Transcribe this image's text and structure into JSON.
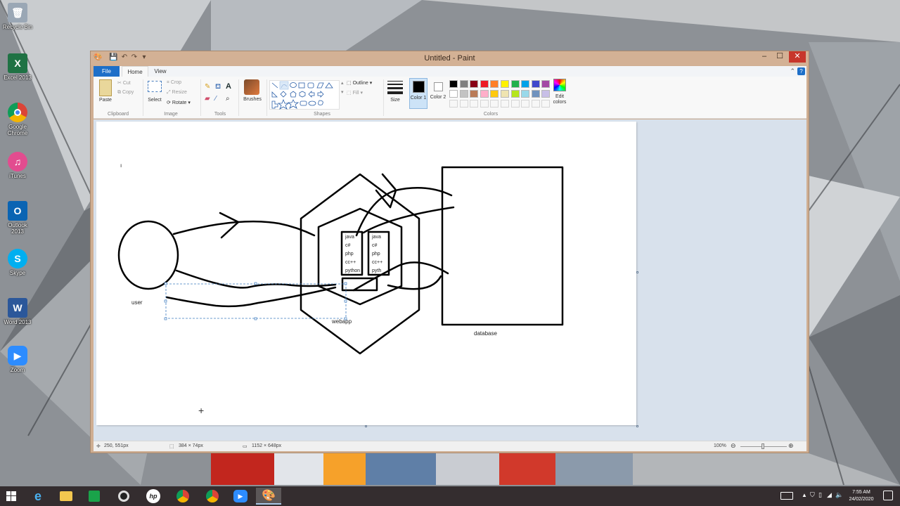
{
  "desktop": {
    "icons": [
      {
        "label": "Recycle Bin",
        "icon": "recycle-bin-icon",
        "color": "#9aa7b5"
      },
      {
        "label": "Excel 2013",
        "icon": "excel-icon",
        "color": "#1f7244"
      },
      {
        "label": "Google Chrome",
        "icon": "chrome-icon",
        "color": "#dd4b39"
      },
      {
        "label": "iTunes",
        "icon": "itunes-icon",
        "color": "#e24c8f"
      },
      {
        "label": "Outlook 2013",
        "icon": "outlook-icon",
        "color": "#0a64b3"
      },
      {
        "label": "Skype",
        "icon": "skype-icon",
        "color": "#00aff0"
      },
      {
        "label": "Word 2013",
        "icon": "word-icon",
        "color": "#2b579a"
      },
      {
        "label": "Zoom",
        "icon": "zoom-icon",
        "color": "#2d8cff"
      }
    ]
  },
  "window": {
    "title": "Untitled - Paint",
    "controls": {
      "minimize": "–",
      "maximize": "☐",
      "close": "✕"
    }
  },
  "ribbon": {
    "tabs": [
      "File",
      "Home",
      "View"
    ],
    "clipboard": {
      "paste": "Paste",
      "cut": "Cut",
      "copy": "Copy",
      "label": "Clipboard"
    },
    "image": {
      "select": "Select",
      "crop": "Crop",
      "resize": "Resize",
      "rotate": "Rotate",
      "label": "Image"
    },
    "tools": {
      "label": "Tools"
    },
    "brushes": "Brushes",
    "shapes": {
      "outline": "Outline",
      "fill": "Fill",
      "label": "Shapes"
    },
    "size": "Size",
    "color1": "Color 1",
    "color2": "Color 2",
    "colors": {
      "label": "Colors",
      "edit": "Edit colors"
    }
  },
  "palette": [
    "#000000",
    "#7f7f7f",
    "#880015",
    "#ed1c24",
    "#ff7f27",
    "#fff200",
    "#22b14c",
    "#00a2e8",
    "#3f48cc",
    "#a349a4",
    "#ffffff",
    "#c3c3c3",
    "#b97a57",
    "#ffaec9",
    "#ffc90e",
    "#efe4b0",
    "#b5e61d",
    "#99d9ea",
    "#7092be",
    "#c8bfe7"
  ],
  "drawing": {
    "stray_mark": "ı",
    "user_label": "user",
    "webapp_label": "webapp",
    "database_label": "database",
    "box1_lines": [
      "java",
      "c#",
      "php",
      "cc++",
      "python"
    ],
    "box2_lines": [
      "java",
      "c#",
      "php",
      "cc++",
      "pyth"
    ]
  },
  "status": {
    "cursor": "250, 551px",
    "selection": "384 × 74px",
    "canvas_size": "1152 × 648px",
    "zoom": "100%"
  },
  "tray": {
    "time": "7:55 AM",
    "date": "24/02/2020"
  }
}
